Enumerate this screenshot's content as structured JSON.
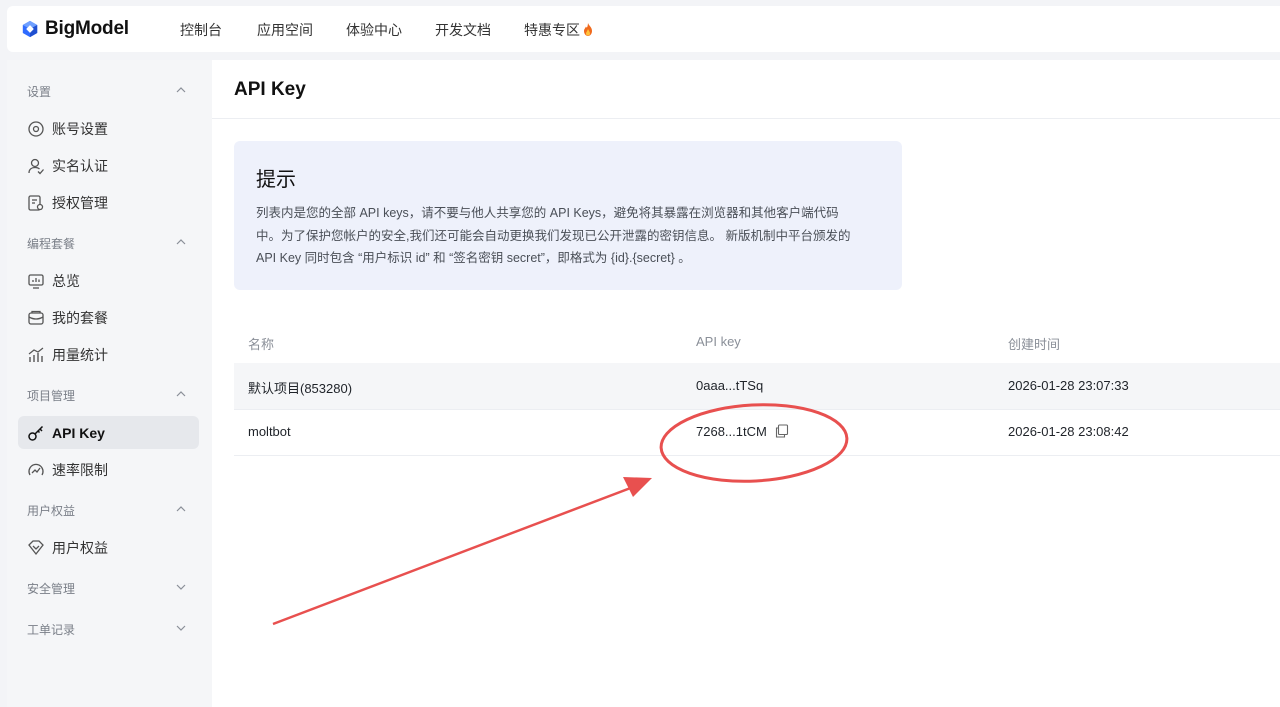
{
  "brand": {
    "name": "BigModel",
    "logo_color": "#2f6bff"
  },
  "nav": {
    "items": [
      {
        "label": "控制台"
      },
      {
        "label": "应用空间"
      },
      {
        "label": "体验中心"
      },
      {
        "label": "开发文档"
      },
      {
        "label": "特惠专区",
        "icon": "fire-icon"
      }
    ]
  },
  "sidebar": {
    "groups": [
      {
        "title": "设置",
        "expanded": true,
        "items": [
          {
            "label": "账号设置",
            "icon": "account-settings-icon"
          },
          {
            "label": "实名认证",
            "icon": "user-verify-icon"
          },
          {
            "label": "授权管理",
            "icon": "authorization-icon"
          }
        ]
      },
      {
        "title": "编程套餐",
        "expanded": true,
        "items": [
          {
            "label": "总览",
            "icon": "overview-monitor-icon"
          },
          {
            "label": "我的套餐",
            "icon": "package-icon"
          },
          {
            "label": "用量统计",
            "icon": "usage-chart-icon"
          }
        ]
      },
      {
        "title": "项目管理",
        "expanded": true,
        "items": [
          {
            "label": "API Key",
            "icon": "key-icon",
            "active": true
          },
          {
            "label": "速率限制",
            "icon": "rate-limit-icon"
          }
        ]
      },
      {
        "title": "用户权益",
        "expanded": true,
        "items": [
          {
            "label": "用户权益",
            "icon": "benefits-icon"
          }
        ]
      },
      {
        "title": "安全管理",
        "expanded": false,
        "items": []
      },
      {
        "title": "工单记录",
        "expanded": false,
        "items": []
      }
    ]
  },
  "main": {
    "title": "API Key",
    "tip": {
      "title": "提示",
      "lines": [
        "列表内是您的全部 API keys，请不要与他人共享您的 API Keys，避免将其暴露在浏览器和其他客户端代码",
        "中。为了保护您帐户的安全,我们还可能会自动更换我们发现已公开泄露的密钥信息。 新版机制中平台颁发的",
        "API Key 同时包含 “用户标识 id” 和 “签名密钥 secret”，即格式为 {id}.{secret} 。"
      ]
    },
    "table": {
      "columns": [
        "名称",
        "API key",
        "创建时间"
      ],
      "rows": [
        {
          "name": "默认项目(853280)",
          "key": "0aaa...tTSq",
          "created": "2026-01-28 23:07:33",
          "copy_icon": false
        },
        {
          "name": "moltbot",
          "key": "7268...1tCM",
          "created": "2026-01-28 23:08:42",
          "copy_icon": true
        }
      ]
    }
  },
  "annotation": {
    "color": "#e8504f"
  }
}
